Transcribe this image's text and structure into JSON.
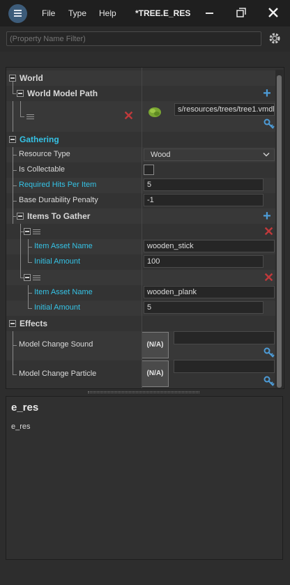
{
  "titlebar": {
    "menu": [
      "File",
      "Type",
      "Help"
    ],
    "document_title": "*TREE.E_RES"
  },
  "filter": {
    "placeholder": "(Property Name Filter)",
    "value": ""
  },
  "properties": {
    "world": {
      "label": "World",
      "model_path_label": "World Model Path",
      "model_path_value": "s/resources/trees/tree1.vmdl"
    },
    "gathering": {
      "label": "Gathering",
      "resource_type_label": "Resource Type",
      "resource_type_value": "Wood",
      "is_collectable_label": "Is Collectable",
      "is_collectable_checked": false,
      "required_hits_label": "Required Hits Per Item",
      "required_hits_value": "5",
      "durability_label": "Base Durability Penalty",
      "durability_value": "-1",
      "items_label": "Items To Gather",
      "items": [
        {
          "asset_label": "Item Asset Name",
          "asset_value": "wooden_stick",
          "amount_label": "Initial Amount",
          "amount_value": "100"
        },
        {
          "asset_label": "Item Asset Name",
          "asset_value": "wooden_plank",
          "amount_label": "Initial Amount",
          "amount_value": "5"
        }
      ]
    },
    "effects": {
      "label": "Effects",
      "sound_label": "Model Change Sound",
      "particle_label": "Model Change Particle",
      "na_label": "(N/A)"
    }
  },
  "description": {
    "title": "e_res",
    "body": "e_res"
  },
  "colors": {
    "accent_cyan": "#35c3e6",
    "add_blue": "#4d9bd6",
    "remove_red": "#c0393b",
    "background": "#2d2d2d"
  }
}
